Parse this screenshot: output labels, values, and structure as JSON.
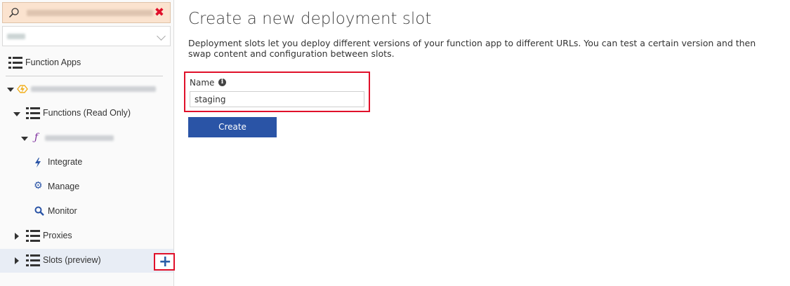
{
  "sidebar": {
    "search": {
      "value": "",
      "clear_icon": "close-x-icon",
      "search_icon": "magnifier-icon"
    },
    "subscription_select": {
      "value": ""
    },
    "function_apps_label": "Function Apps",
    "functions_label": "Functions (Read Only)",
    "integrate_label": "Integrate",
    "manage_label": "Manage",
    "monitor_label": "Monitor",
    "proxies_label": "Proxies",
    "slots_label": "Slots (preview)",
    "add_slot_symbol": "+"
  },
  "main": {
    "title": "Create a new deployment slot",
    "description": "Deployment slots let you deploy different versions of your function app to different URLs. You can test a certain version and then swap content and configuration between slots.",
    "name_label": "Name",
    "info_glyph": "i",
    "name_value": "staging",
    "create_label": "Create"
  },
  "colors": {
    "accent": "#2a54a6",
    "highlight_border": "#e0102a",
    "search_bg": "#fbe3cf",
    "selected_row": "#e8edf5"
  }
}
